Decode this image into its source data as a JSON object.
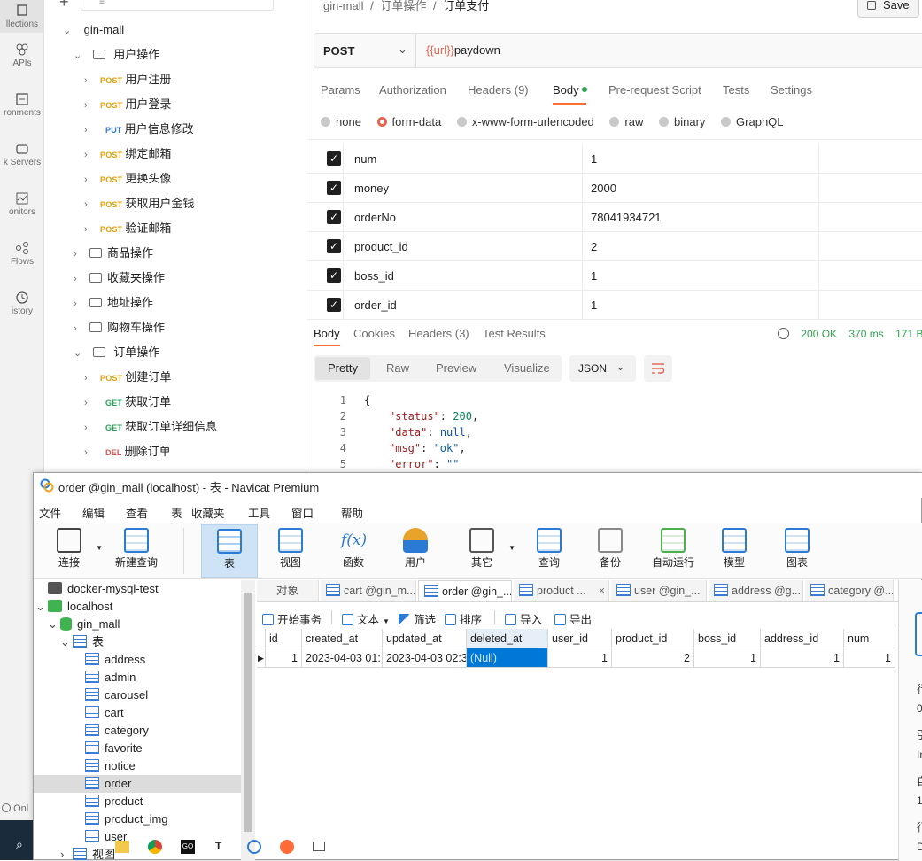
{
  "rail": {
    "items": [
      {
        "label": "llections",
        "icon": "collections-icon"
      },
      {
        "label": "APIs",
        "icon": "apis-icon"
      },
      {
        "label": "ronments",
        "icon": "environments-icon"
      },
      {
        "label": "k Servers",
        "icon": "mock-servers-icon"
      },
      {
        "label": "onitors",
        "icon": "monitors-icon"
      },
      {
        "label": "Flows",
        "icon": "flows-icon"
      },
      {
        "label": "istory",
        "icon": "history-icon"
      }
    ],
    "status": "Onl"
  },
  "tree": {
    "search_placeholder": "",
    "root": "gin-mall",
    "folder_user": "用户操作",
    "user_requests": [
      {
        "method": "POST",
        "name": "用户注册"
      },
      {
        "method": "POST",
        "name": "用户登录"
      },
      {
        "method": "PUT",
        "name": "用户信息修改"
      },
      {
        "method": "POST",
        "name": "绑定邮箱"
      },
      {
        "method": "POST",
        "name": "更换头像"
      },
      {
        "method": "POST",
        "name": "获取用户金钱"
      },
      {
        "method": "POST",
        "name": "验证邮箱"
      }
    ],
    "folders": [
      "商品操作",
      "收藏夹操作",
      "地址操作",
      "购物车操作"
    ],
    "folder_order": "订单操作",
    "order_requests": [
      {
        "method": "POST",
        "name": "创建订单"
      },
      {
        "method": "GET",
        "name": "获取订单"
      },
      {
        "method": "GET",
        "name": "获取订单详细信息"
      },
      {
        "method": "DEL",
        "name": "删除订单"
      }
    ]
  },
  "request": {
    "breadcrumb": [
      "gin-mall",
      "订单操作",
      "订单支付"
    ],
    "save_label": "Save",
    "method": "POST",
    "url_var": "{{url}}",
    "url_path": "paydown",
    "tabs": [
      "Params",
      "Authorization",
      "Headers (9)",
      "Body",
      "Pre-request Script",
      "Tests",
      "Settings"
    ],
    "body_modes": [
      "none",
      "form-data",
      "x-www-form-urlencoded",
      "raw",
      "binary",
      "GraphQL"
    ],
    "form_data": [
      {
        "key": "num",
        "value": "1"
      },
      {
        "key": "money",
        "value": "2000"
      },
      {
        "key": "orderNo",
        "value": "78041934721"
      },
      {
        "key": "product_id",
        "value": "2"
      },
      {
        "key": "boss_id",
        "value": "1"
      },
      {
        "key": "order_id",
        "value": "1"
      }
    ]
  },
  "response": {
    "tabs": [
      "Body",
      "Cookies",
      "Headers (3)",
      "Test Results"
    ],
    "status": "200 OK",
    "time": "370 ms",
    "size": "171 B",
    "view_modes": [
      "Pretty",
      "Raw",
      "Preview",
      "Visualize"
    ],
    "format": "JSON",
    "lines": [
      {
        "n": "1",
        "text": "{"
      },
      {
        "n": "2",
        "key": "\"status\"",
        "val": "200",
        "vtype": "num",
        "comma": ","
      },
      {
        "n": "3",
        "key": "\"data\"",
        "val": "null",
        "vtype": "kw",
        "comma": ","
      },
      {
        "n": "4",
        "key": "\"msg\"",
        "val": "\"ok\"",
        "vtype": "str",
        "comma": ","
      },
      {
        "n": "5",
        "key": "\"error\"",
        "val": "\"\"",
        "vtype": "str",
        "comma": ""
      }
    ]
  },
  "navicat": {
    "title": "order @gin_mall (localhost) - 表 - Navicat Premium",
    "menu": [
      "文件",
      "编辑",
      "查看",
      "表",
      "收藏夹",
      "工具",
      "窗口",
      "帮助"
    ],
    "toolbar": [
      "连接",
      "新建查询",
      "表",
      "视图",
      "函数",
      "用户",
      "其它",
      "查询",
      "备份",
      "自动运行",
      "模型",
      "图表"
    ],
    "nav": {
      "conn1": "docker-mysql-test",
      "conn2": "localhost",
      "db": "gin_mall",
      "tables_label": "表",
      "tables": [
        "address",
        "admin",
        "carousel",
        "cart",
        "category",
        "favorite",
        "notice",
        "order",
        "product",
        "product_img",
        "user"
      ],
      "selected": "order",
      "views_label": "视图"
    },
    "tabs": [
      "对象",
      "cart @gin_m...",
      "order @gin_...",
      "product ...",
      "user @gin_...",
      "address @g...",
      "category @..."
    ],
    "actions": [
      "开始事务",
      "文本",
      "筛选",
      "排序",
      "导入",
      "导出"
    ],
    "columns": [
      "id",
      "created_at",
      "updated_at",
      "deleted_at",
      "user_id",
      "product_id",
      "boss_id",
      "address_id",
      "num"
    ],
    "row": [
      "1",
      "2023-04-03 01:",
      "2023-04-03 02:3",
      "(Null)",
      "1",
      "2",
      "1",
      "1",
      "1"
    ],
    "right_panel": [
      "行",
      "0",
      "引",
      "In",
      "自",
      "1",
      "行",
      "D"
    ]
  },
  "colors": {
    "accent_postman": "#ff6c37",
    "selection": "#0078d7",
    "green_dot": "#2ea44f"
  }
}
